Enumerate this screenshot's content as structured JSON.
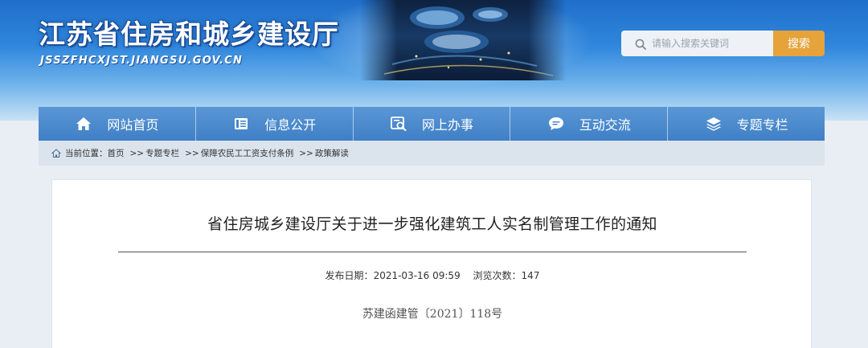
{
  "header": {
    "site_title": "江苏省住房和城乡建设厅",
    "site_url": "JSSZFHCXJST.JIANGSU.GOV.CN",
    "search": {
      "placeholder": "请输入搜索关键词",
      "button_label": "搜索",
      "icon": "search-icon"
    },
    "banner_image": "stadium-photo"
  },
  "nav": {
    "items": [
      {
        "label": "网站首页",
        "icon": "home-icon"
      },
      {
        "label": "信息公开",
        "icon": "document-icon"
      },
      {
        "label": "网上办事",
        "icon": "online-service-icon"
      },
      {
        "label": "互动交流",
        "icon": "chat-icon"
      },
      {
        "label": "专题专栏",
        "icon": "layers-icon"
      }
    ]
  },
  "breadcrumb": {
    "prefix": "当前位置：",
    "items": [
      "首页",
      "专题专栏",
      "保障农民工工资支付条例",
      "政策解读"
    ],
    "separator": ">>"
  },
  "article": {
    "title": "省住房城乡建设厅关于进一步强化建筑工人实名制管理工作的通知",
    "publish_label": "发布日期：",
    "publish_date": "2021-03-16 09:59",
    "views_label": "浏览次数：",
    "views": "147",
    "doc_number": "苏建函建管〔2021〕118号"
  },
  "colors": {
    "nav_bg": "#4a88cc",
    "search_button": "#e6a33a",
    "breadcrumb_bg": "#dbe3ec"
  }
}
